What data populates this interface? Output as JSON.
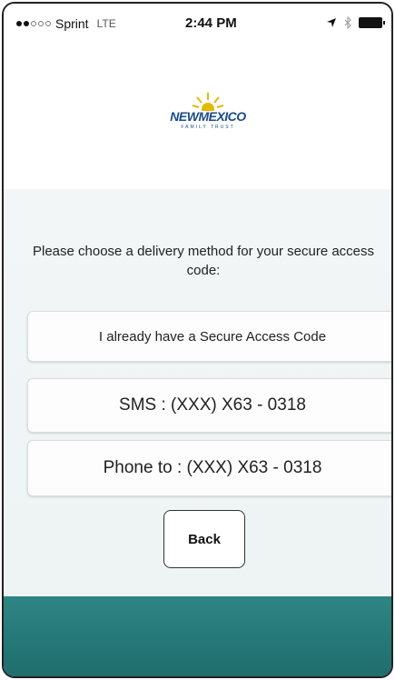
{
  "status_bar": {
    "carrier": "Sprint",
    "network": "LTE",
    "time": "2:44 PM"
  },
  "logo": {
    "text": "NEWMEXICO",
    "subtext": "FAMILY TRUST"
  },
  "prompt": {
    "text": "Please choose a delivery method for your secure access code:"
  },
  "buttons": {
    "existing_code": "I already have a Secure Access Code",
    "sms": "SMS : (XXX) X63 - 0318",
    "phone": "Phone to : (XXX) X63 - 0318",
    "back": "Back"
  },
  "colors": {
    "footer": "#2f8585",
    "logo_blue": "#1a4a8a",
    "logo_sun": "#e6b800"
  }
}
